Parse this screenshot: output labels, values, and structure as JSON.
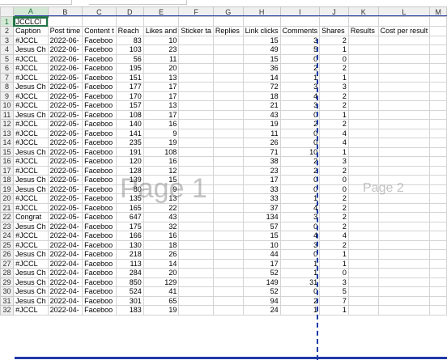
{
  "sheet": {
    "columns": [
      "A",
      "B",
      "C",
      "D",
      "E",
      "F",
      "G",
      "H",
      "I",
      "J",
      "K",
      "L",
      "M"
    ],
    "selected_column": "A",
    "selected_row": "1",
    "active_cell_value": "JCCLCI",
    "headers": [
      "Caption",
      "Post time",
      "Content t",
      "Reach",
      "Likes and",
      "Sticker ta",
      "Replies",
      "Link clicks",
      "Comments",
      "Shares",
      "Results",
      "Cost per result",
      ""
    ],
    "rows": [
      [
        "#JCCL",
        "2022-06-",
        "Faceboo",
        "83",
        "10",
        "",
        "",
        "15",
        "3",
        "2"
      ],
      [
        "Jesus Ch",
        "2022-06-",
        "Faceboo",
        "103",
        "23",
        "",
        "",
        "49",
        "5",
        "1"
      ],
      [
        "#JCCL",
        "2022-06-",
        "Faceboo",
        "56",
        "11",
        "",
        "",
        "15",
        "0",
        "0"
      ],
      [
        "#JCCL",
        "2022-06-",
        "Faceboo",
        "195",
        "20",
        "",
        "",
        "36",
        "2",
        "2"
      ],
      [
        "#JCCL",
        "2022-05-",
        "Faceboo",
        "151",
        "13",
        "",
        "",
        "14",
        "1",
        "1"
      ],
      [
        "Jesus Ch",
        "2022-05-",
        "Faceboo",
        "177",
        "17",
        "",
        "",
        "72",
        "3",
        "3"
      ],
      [
        "#JCCL",
        "2022-05-",
        "Faceboo",
        "170",
        "17",
        "",
        "",
        "18",
        "4",
        "2"
      ],
      [
        "#JCCL",
        "2022-05-",
        "Faceboo",
        "157",
        "13",
        "",
        "",
        "21",
        "3",
        "2"
      ],
      [
        "Jesus Ch",
        "2022-05-",
        "Faceboo",
        "108",
        "17",
        "",
        "",
        "43",
        "0",
        "1"
      ],
      [
        "#JCCL",
        "2022-05-",
        "Faceboo",
        "140",
        "16",
        "",
        "",
        "19",
        "2",
        "2"
      ],
      [
        "#JCCL",
        "2022-05-",
        "Faceboo",
        "141",
        "9",
        "",
        "",
        "11",
        "0",
        "4"
      ],
      [
        "#JCCL",
        "2022-05-",
        "Faceboo",
        "235",
        "19",
        "",
        "",
        "26",
        "0",
        "4"
      ],
      [
        "Jesus Ch",
        "2022-05-",
        "Faceboo",
        "191",
        "108",
        "",
        "",
        "71",
        "10",
        "1"
      ],
      [
        "#JCCL",
        "2022-05-",
        "Faceboo",
        "120",
        "16",
        "",
        "",
        "38",
        "2",
        "3"
      ],
      [
        "#JCCL",
        "2022-05-",
        "Faceboo",
        "128",
        "12",
        "",
        "",
        "23",
        "2",
        "2"
      ],
      [
        "Jesus Ch",
        "2022-05-",
        "Faceboo",
        "139",
        "15",
        "",
        "",
        "17",
        "0",
        "0"
      ],
      [
        "Jesus Ch",
        "2022-05-",
        "Faceboo",
        "80",
        "9",
        "",
        "",
        "33",
        "0",
        "0"
      ],
      [
        "#JCCL",
        "2022-05-",
        "Faceboo",
        "135",
        "13",
        "",
        "",
        "33",
        "1",
        "2"
      ],
      [
        "#JCCL",
        "2022-05-",
        "Faceboo",
        "165",
        "22",
        "",
        "",
        "37",
        "4",
        "2"
      ],
      [
        "Congrat",
        "2022-05-",
        "Faceboo",
        "647",
        "43",
        "",
        "",
        "134",
        "3",
        "2"
      ],
      [
        "Jesus Ch",
        "2022-04-",
        "Faceboo",
        "175",
        "32",
        "",
        "",
        "57",
        "0",
        "2"
      ],
      [
        "#JCCL",
        "2022-04-",
        "Faceboo",
        "166",
        "16",
        "",
        "",
        "15",
        "4",
        "4"
      ],
      [
        "#JCCL",
        "2022-04-",
        "Faceboo",
        "130",
        "18",
        "",
        "",
        "10",
        "3",
        "2"
      ],
      [
        "Jesus Ch",
        "2022-04-",
        "Faceboo",
        "218",
        "26",
        "",
        "",
        "44",
        "0",
        "1"
      ],
      [
        "#JCCL",
        "2022-04-",
        "Faceboo",
        "113",
        "14",
        "",
        "",
        "17",
        "1",
        "1"
      ],
      [
        "Jesus Ch",
        "2022-04-",
        "Faceboo",
        "284",
        "20",
        "",
        "",
        "52",
        "1",
        "0"
      ],
      [
        "Jesus Ch",
        "2022-04-",
        "Faceboo",
        "850",
        "129",
        "",
        "",
        "149",
        "31",
        "3"
      ],
      [
        "Jesus Ch",
        "2022-04-",
        "Faceboo",
        "524",
        "41",
        "",
        "",
        "52",
        "0",
        "5"
      ],
      [
        "Jesus Ch",
        "2022-04-",
        "Faceboo",
        "301",
        "65",
        "",
        "",
        "94",
        "2",
        "7"
      ],
      [
        "#JCCL",
        "2022-04-",
        "Faceboo",
        "183",
        "19",
        "",
        "",
        "24",
        "1",
        "1"
      ]
    ]
  },
  "watermarks": {
    "page1": "Page 1",
    "page2": "Page 2"
  }
}
